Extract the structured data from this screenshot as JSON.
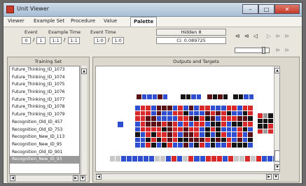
{
  "window": {
    "title": "Unit Viewer",
    "controls": {
      "minimize": "–",
      "maximize": "□",
      "close": "✕"
    }
  },
  "menu": {
    "items": [
      "Viewer",
      "Example Set",
      "Procedure",
      "Value",
      "Palette"
    ],
    "selected_index": 4
  },
  "controls": {
    "event_label": "Event",
    "example_time_label": "Example Time",
    "event_time_label": "Event Time",
    "event_value": "0",
    "event_total": "1",
    "example_time_value": "1:1",
    "example_time_total": "1:1",
    "event_time_value": "1:0",
    "event_time_total": "1:0",
    "slash": "/",
    "hidden_label": "Hidden 8",
    "hidden_value": "Ci: 0.089725",
    "nav_first": "⊲",
    "nav_prev_fast": "⊲",
    "nav_prev": "◁",
    "nav_next": "▷",
    "nav_next_fast": "⊳",
    "nav_last": "⊳",
    "nav2_a": "⊳",
    "nav2_b": "⊳"
  },
  "training_set": {
    "title": "Training Set",
    "items": [
      "Future_Thinking_ID_1073",
      "Future_Thinking_ID_1074",
      "Future_Thinking_ID_1075",
      "Future_Thinking_ID_1076",
      "Future_Thinking_ID_1077",
      "Future_Thinking_ID_1078",
      "Future_Thinking_ID_1079",
      "Recognition_Old_ID_457",
      "Recognition_Old_ID_753",
      "Recognition_New_ID_113",
      "Recognition_New_ID_95",
      "Recognition_Old_ID_901",
      "Recognition_New_ID_93"
    ],
    "selected_index": 12
  },
  "outputs": {
    "title": "Outputs and Targets"
  },
  "colors": {
    "blue": "#2f4fd0",
    "red": "#d8282a",
    "dark": "#141414",
    "darkred": "#5a1014",
    "gray": "#9a9a9a",
    "lightgray": "#c8c8c8"
  }
}
